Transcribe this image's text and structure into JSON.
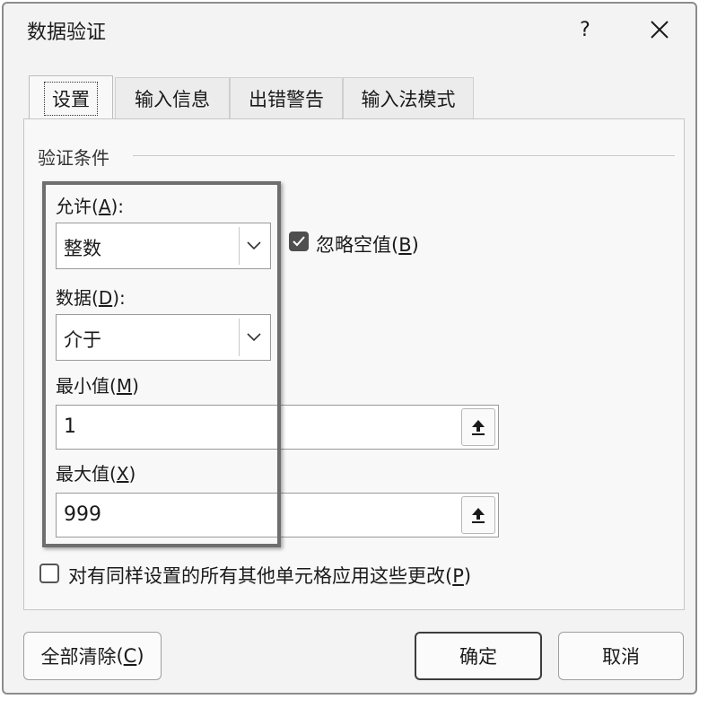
{
  "window": {
    "title": "数据验证",
    "help_label": "?"
  },
  "tabs": [
    {
      "label": "设置",
      "active": true
    },
    {
      "label": "输入信息",
      "active": false
    },
    {
      "label": "出错警告",
      "active": false
    },
    {
      "label": "输入法模式",
      "active": false
    }
  ],
  "settings": {
    "section_title": "验证条件",
    "allow": {
      "label": "允许",
      "key": "A",
      "value": "整数"
    },
    "ignore_blank": {
      "label": "忽略空值",
      "key": "B",
      "checked": true
    },
    "data": {
      "label": "数据",
      "key": "D",
      "value": "介于"
    },
    "minimum": {
      "label": "最小值",
      "key": "M",
      "value": "1"
    },
    "maximum": {
      "label": "最大值",
      "key": "X",
      "value": "999"
    },
    "apply_all": {
      "label": "对有同样设置的所有其他单元格应用这些更改",
      "key": "P",
      "checked": false
    }
  },
  "buttons": {
    "clear_all": {
      "label": "全部清除",
      "key": "C"
    },
    "ok": {
      "label": "确定"
    },
    "cancel": {
      "label": "取消"
    }
  },
  "icons": {
    "close": "close-icon",
    "dropdown": "chevron-down-icon",
    "collapse": "collapse-dialog-icon",
    "check": "checkmark-icon"
  },
  "colors": {
    "dialog_bg": "#f3f3f3",
    "highlight_border": "#6e6e6e",
    "checkbox_fill": "#4f4f4f"
  }
}
